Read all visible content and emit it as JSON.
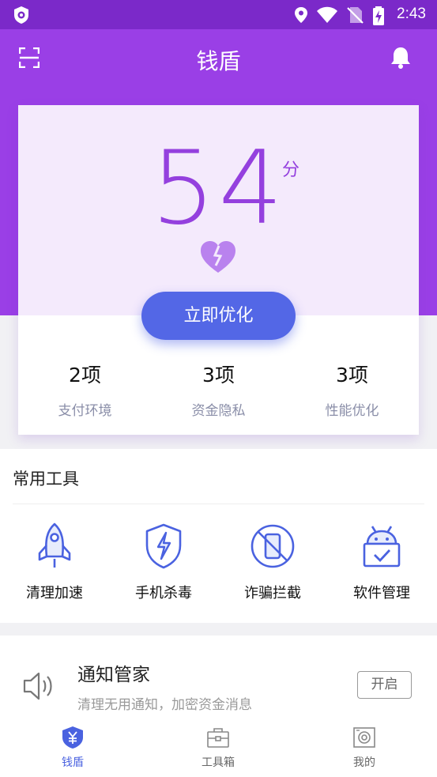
{
  "status_bar": {
    "time": "2:43"
  },
  "header": {
    "title": "钱盾"
  },
  "score": {
    "value": "54",
    "unit": "分",
    "button_label": "立即优化",
    "stats": [
      {
        "count": "2项",
        "label": "支付环境"
      },
      {
        "count": "3项",
        "label": "资金隐私"
      },
      {
        "count": "3项",
        "label": "性能优化"
      }
    ]
  },
  "tools": {
    "title": "常用工具",
    "items": [
      {
        "label": "清理加速",
        "icon": "rocket-icon"
      },
      {
        "label": "手机杀毒",
        "icon": "shield-bolt-icon"
      },
      {
        "label": "诈骗拦截",
        "icon": "phone-block-icon"
      },
      {
        "label": "软件管理",
        "icon": "android-check-icon"
      }
    ]
  },
  "notify": {
    "title": "通知管家",
    "subtitle": "清理无用通知，加密资金消息",
    "button_label": "开启"
  },
  "bottom_nav": {
    "items": [
      {
        "label": "钱盾",
        "active": true
      },
      {
        "label": "工具箱",
        "active": false
      },
      {
        "label": "我的",
        "active": false
      }
    ]
  },
  "colors": {
    "primary_purple": "#9a3fe6",
    "status_purple": "#7b29c9",
    "button_blue": "#5367e6",
    "icon_blue": "#4a62e0"
  }
}
